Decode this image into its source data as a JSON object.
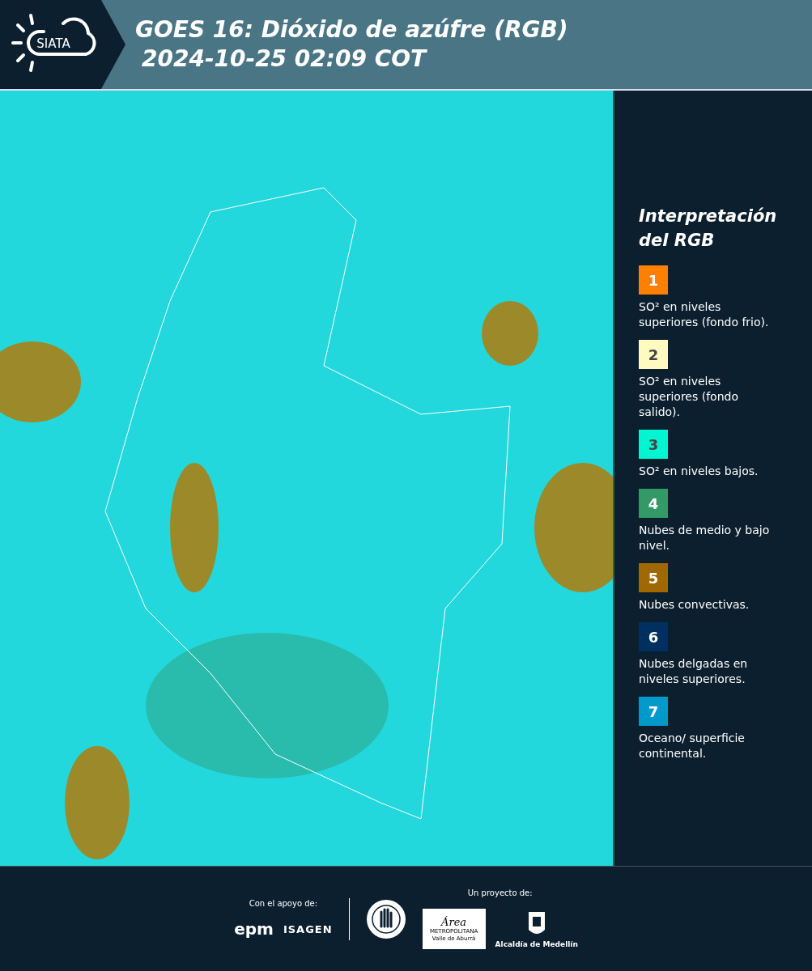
{
  "header": {
    "logo_text": "SIATA",
    "title": "GOES 16: Dióxido de azúfre (RGB)",
    "subtitle": "2024-10-25 02:09 COT"
  },
  "legend": {
    "title": "Interpretación del RGB",
    "items": [
      {
        "number": "1",
        "color": "#ff7f00",
        "text": "SO² en niveles superiores (fondo frio)."
      },
      {
        "number": "2",
        "color": "#fffac0",
        "text": "SO² en niveles superiores (fondo salido)."
      },
      {
        "number": "3",
        "color": "#00f5d0",
        "text": "SO² en niveles bajos."
      },
      {
        "number": "4",
        "color": "#339966",
        "text": "Nubes de medio y bajo nivel."
      },
      {
        "number": "5",
        "color": "#a06800",
        "text": "Nubes convectivas."
      },
      {
        "number": "6",
        "color": "#003060",
        "text": "Nubes delgadas en niveles superiores."
      },
      {
        "number": "7",
        "color": "#0099cc",
        "text": "Oceano/ superficie continental."
      }
    ]
  },
  "footer": {
    "support_label": "Con el apoyo de:",
    "support_logos": [
      "epm",
      "ISAGEN"
    ],
    "project_label": "Un proyecto de:",
    "area_logo": {
      "script": "Área",
      "line_1": "METROPOLITANA",
      "line_2": "Valle de Aburrá"
    },
    "city_logo": "Alcaldía de Medellín"
  }
}
